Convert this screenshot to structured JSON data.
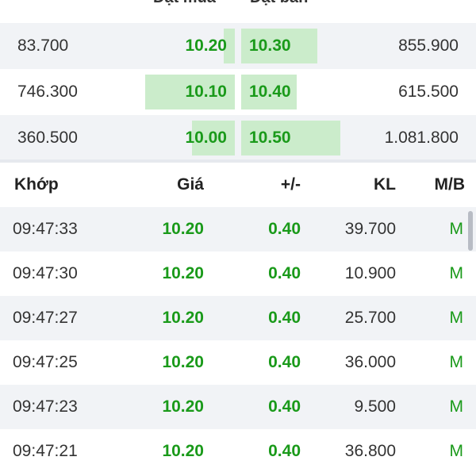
{
  "order_book": {
    "header": {
      "bid": "Đặt mua",
      "ask": "Đặt bán"
    },
    "rows": [
      {
        "bid_volume": "83.700",
        "bid_price": "10.20",
        "ask_price": "10.30",
        "ask_volume": "855.900",
        "bid_bar": 0.08,
        "ask_bar": 0.55
      },
      {
        "bid_volume": "746.300",
        "bid_price": "10.10",
        "ask_price": "10.40",
        "ask_volume": "615.500",
        "bid_bar": 0.65,
        "ask_bar": 0.4
      },
      {
        "bid_volume": "360.500",
        "bid_price": "10.00",
        "ask_price": "10.50",
        "ask_volume": "1.081.800",
        "bid_bar": 0.31,
        "ask_bar": 0.72
      }
    ]
  },
  "trades": {
    "headers": {
      "time": "Khớp",
      "price": "Giá",
      "change": "+/-",
      "volume": "KL",
      "side": "M/B"
    },
    "rows": [
      {
        "time": "09:47:33",
        "price": "10.20",
        "change": "0.40",
        "volume": "39.700",
        "side": "M"
      },
      {
        "time": "09:47:30",
        "price": "10.20",
        "change": "0.40",
        "volume": "10.900",
        "side": "M"
      },
      {
        "time": "09:47:27",
        "price": "10.20",
        "change": "0.40",
        "volume": "25.700",
        "side": "M"
      },
      {
        "time": "09:47:25",
        "price": "10.20",
        "change": "0.40",
        "volume": "36.000",
        "side": "M"
      },
      {
        "time": "09:47:23",
        "price": "10.20",
        "change": "0.40",
        "volume": "9.500",
        "side": "M"
      },
      {
        "time": "09:47:21",
        "price": "10.20",
        "change": "0.40",
        "volume": "36.800",
        "side": "M"
      }
    ]
  },
  "colors": {
    "up": "#1a9a1a",
    "bar": "#cbeccb",
    "row_alt": "#f1f3f6"
  }
}
